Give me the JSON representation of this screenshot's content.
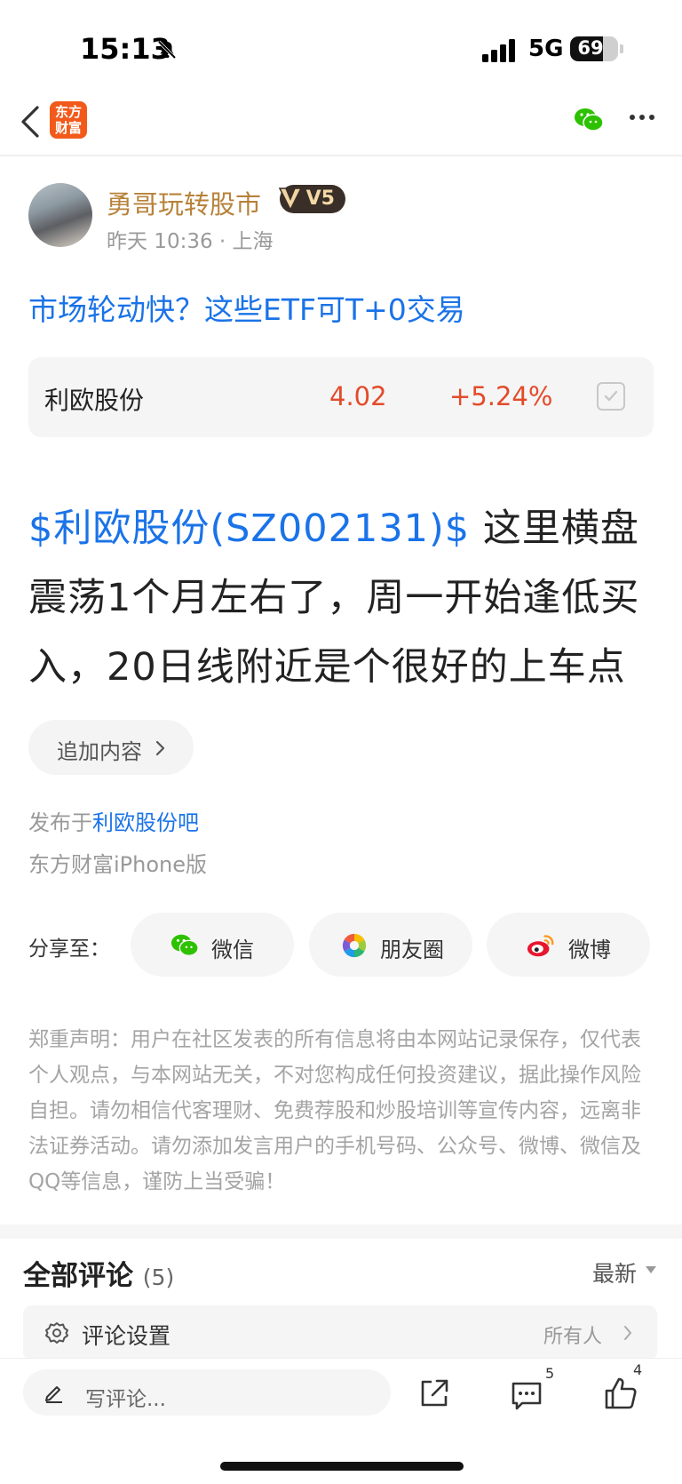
{
  "status_bar": {
    "time": "15:13",
    "network": "5G",
    "battery": "69",
    "battery_level": 0.69
  },
  "nav": {
    "logo_line1": "东方",
    "logo_line2": "财富"
  },
  "author": {
    "name": "勇哥玩转股市",
    "level": "V5",
    "meta": "昨天 10:36 · 上海"
  },
  "topic": "市场轮动快？这些ETF可T+0交易",
  "stock": {
    "name": "利欧股份",
    "price": "4.02",
    "change": "+5.24%"
  },
  "post": {
    "stock_tag": "$利欧股份(SZ002131)$",
    "text": "  这里横盘震荡1个月左右了，周一开始逢低买入，20日线附近是个很好的上车点"
  },
  "add_content_label": "追加内容",
  "publish": {
    "prefix": "发布于",
    "bar": "利欧股份吧",
    "client": "东方财富iPhone版"
  },
  "share": {
    "label": "分享至：",
    "targets": [
      {
        "label": "微信",
        "icon": "wechat-icon"
      },
      {
        "label": "朋友圈",
        "icon": "moments-icon"
      },
      {
        "label": "微博",
        "icon": "weibo-icon"
      }
    ]
  },
  "disclaimer": "郑重声明：用户在社区发表的所有信息将由本网站记录保存，仅代表个人观点，与本网站无关，不对您构成任何投资建议，据此操作风险自担。请勿相信代客理财、免费荐股和炒股培训等宣传内容，远离非法证券活动。请勿添加发言用户的手机号码、公众号、微博、微信及QQ等信息，谨防上当受骗！",
  "comments": {
    "title": "全部评论",
    "count": "(5)",
    "sort": "最新"
  },
  "comment_settings": {
    "label": "评论设置",
    "value": "所有人"
  },
  "bottom_bar": {
    "placeholder": "写评论...",
    "comment_count": "5",
    "like_count": "4"
  },
  "colors": {
    "link": "#1a73e8",
    "up": "#e34b2b",
    "author": "#b7823a",
    "brand": "#f25a1b"
  }
}
